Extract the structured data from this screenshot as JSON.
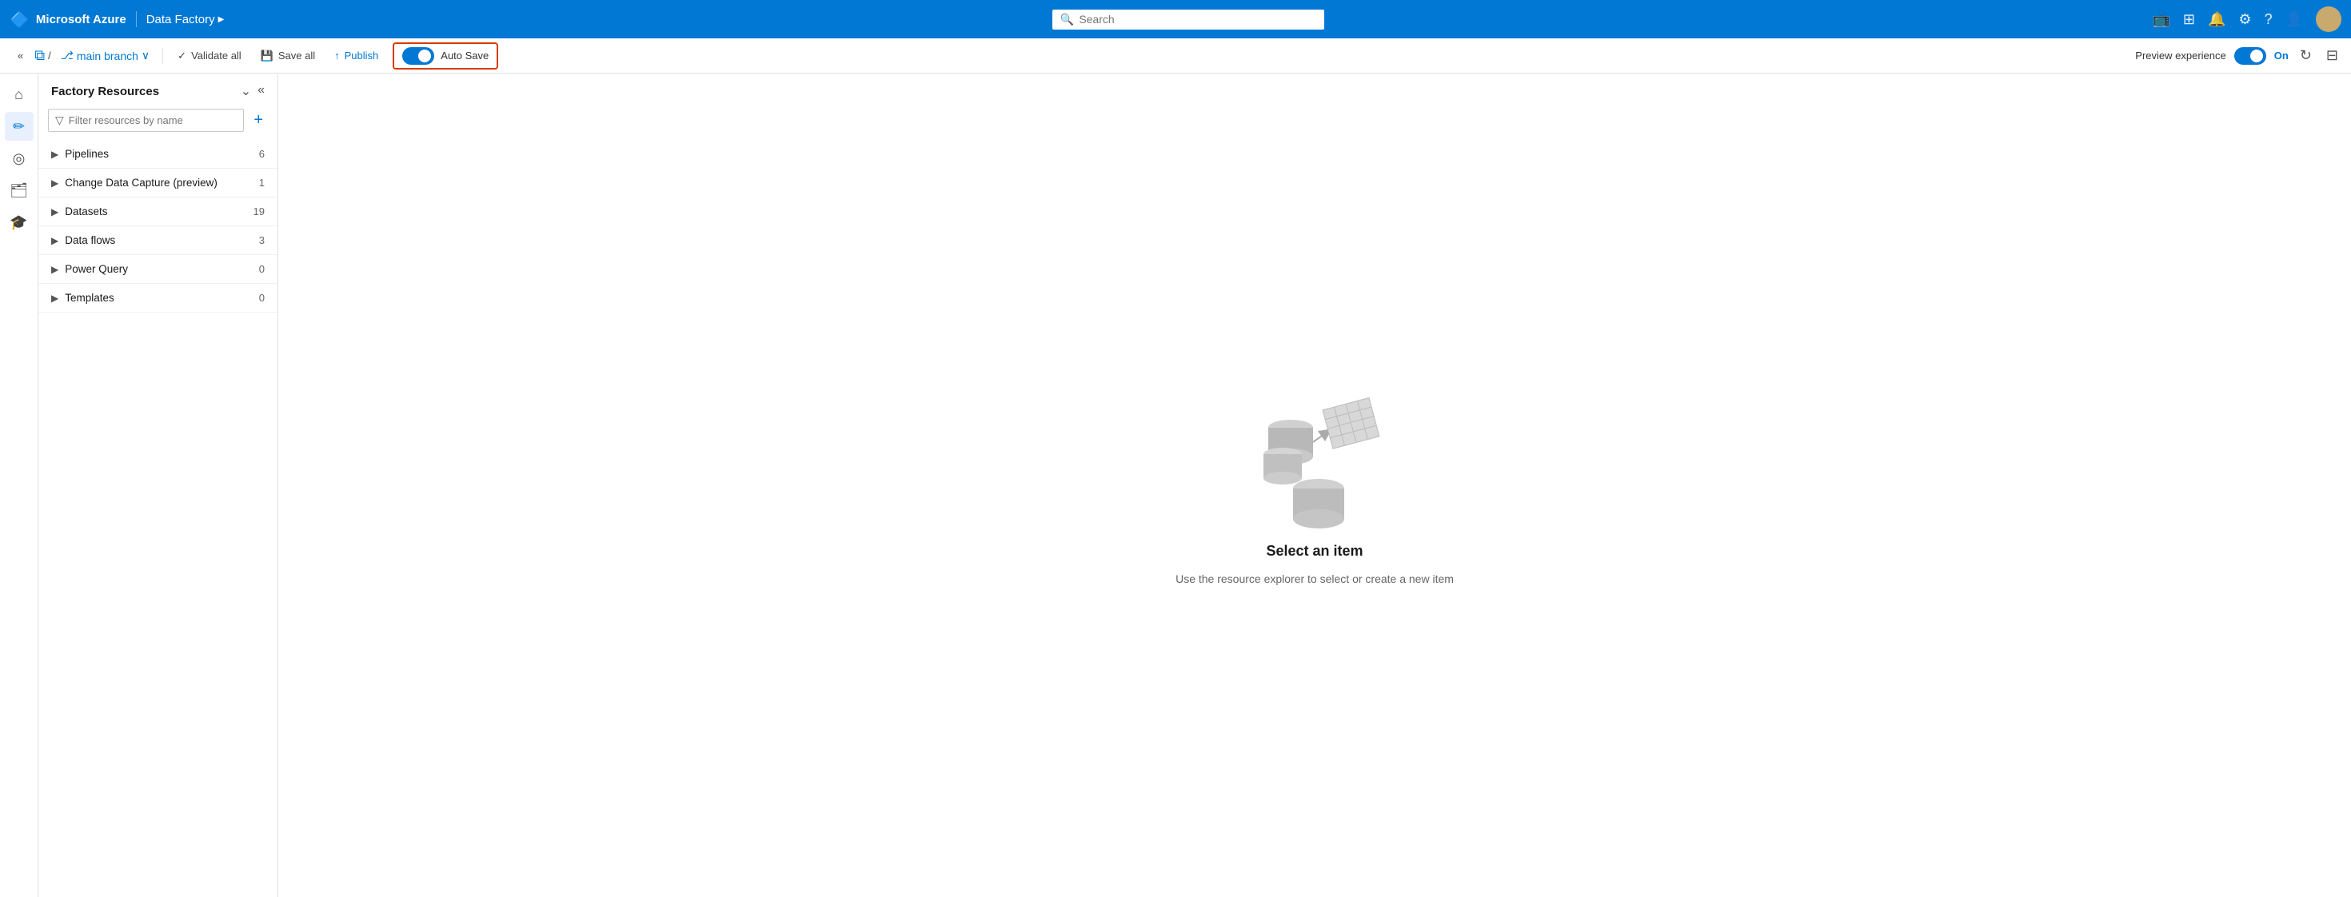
{
  "topNav": {
    "brand": "Microsoft Azure",
    "divider": "|",
    "appName": "Data Factory",
    "chevron": "▶",
    "search": {
      "placeholder": "Search"
    },
    "icons": [
      "📺",
      "⊞",
      "🔔",
      "⚙",
      "?",
      "👤"
    ]
  },
  "toolbar": {
    "collapseIcon": "«",
    "branchIcon": "⌥",
    "slash": "/",
    "branchBranchIcon": "⎇",
    "branchName": "main branch",
    "branchChevron": "∨",
    "validateAll": "Validate all",
    "saveAll": "Save all",
    "publish": "Publish",
    "autoSave": "Auto Save",
    "previewExperience": "Preview experience",
    "previewOn": "On",
    "refreshIcon": "↻",
    "gridIcon": "⊞"
  },
  "factoryPanel": {
    "title": "Factory Resources",
    "collapseIcon": "⌄",
    "hideIcon": "«",
    "addIcon": "+",
    "filterPlaceholder": "Filter resources by name",
    "resources": [
      {
        "name": "Pipelines",
        "count": "6"
      },
      {
        "name": "Change Data Capture (preview)",
        "count": "1"
      },
      {
        "name": "Datasets",
        "count": "19"
      },
      {
        "name": "Data flows",
        "count": "3"
      },
      {
        "name": "Power Query",
        "count": "0"
      },
      {
        "name": "Templates",
        "count": "0"
      }
    ]
  },
  "emptyState": {
    "title": "Select an item",
    "subtitle": "Use the resource explorer to select or create a new item"
  },
  "sidebarIcons": [
    {
      "name": "home-icon",
      "symbol": "⌂",
      "active": false
    },
    {
      "name": "edit-icon",
      "symbol": "✏",
      "active": true
    },
    {
      "name": "monitor-icon",
      "symbol": "◎",
      "active": false
    },
    {
      "name": "briefcase-icon",
      "symbol": "💼",
      "active": false
    },
    {
      "name": "graduation-icon",
      "symbol": "🎓",
      "active": false
    }
  ]
}
